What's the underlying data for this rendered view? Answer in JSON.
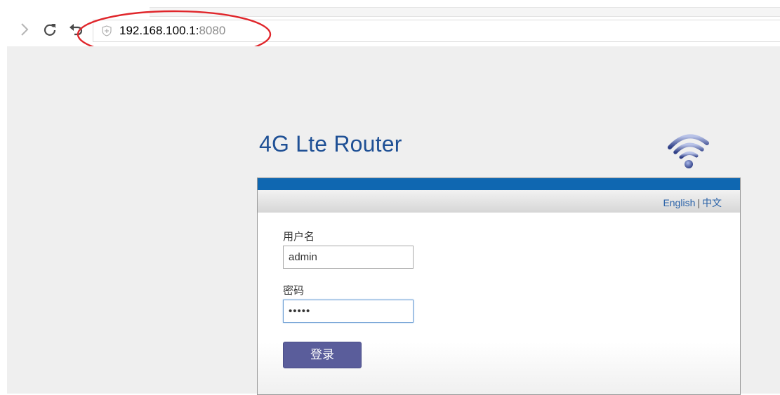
{
  "browser": {
    "forward_icon": "chevron-right-icon",
    "reload_icon": "reload-icon",
    "undo_icon": "undo-icon",
    "security_icon": "shield-icon",
    "url_host": "192.168.100.1:",
    "url_port": "8080",
    "annotation_color": "#e0262b"
  },
  "page": {
    "title": "4G Lte Router",
    "logo_icon": "wifi-icon",
    "colors": {
      "title": "#1f5095",
      "panel_topbar": "#0f67b1",
      "login_button": "#5a5d9b"
    },
    "language": {
      "english": "English",
      "separator": "|",
      "chinese": "中文"
    },
    "form": {
      "username_label": "用户名",
      "username_value": "admin",
      "password_label": "密码",
      "password_value": "admin",
      "login_button_label": "登录"
    }
  }
}
